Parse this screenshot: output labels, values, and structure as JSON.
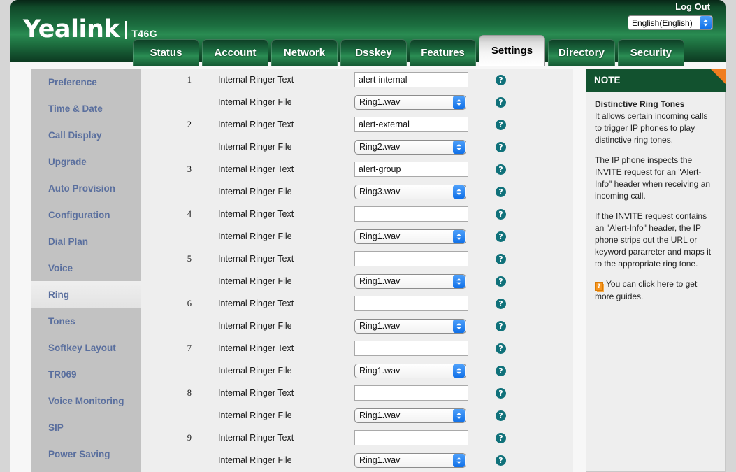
{
  "header": {
    "brand": "Yealink",
    "model": "T46G",
    "logout_label": "Log Out",
    "language_value": "English(English)",
    "accent_green": "#1c6f40",
    "accent_dark_green": "#12522f"
  },
  "tabs": [
    {
      "label": "Status",
      "active": false
    },
    {
      "label": "Account",
      "active": false
    },
    {
      "label": "Network",
      "active": false
    },
    {
      "label": "Dsskey",
      "active": false
    },
    {
      "label": "Features",
      "active": false
    },
    {
      "label": "Settings",
      "active": true
    },
    {
      "label": "Directory",
      "active": false
    },
    {
      "label": "Security",
      "active": false
    }
  ],
  "sidebar": {
    "items": [
      {
        "label": "Preference",
        "active": false
      },
      {
        "label": "Time & Date",
        "active": false
      },
      {
        "label": "Call Display",
        "active": false
      },
      {
        "label": "Upgrade",
        "active": false
      },
      {
        "label": "Auto Provision",
        "active": false
      },
      {
        "label": "Configuration",
        "active": false
      },
      {
        "label": "Dial Plan",
        "active": false
      },
      {
        "label": "Voice",
        "active": false
      },
      {
        "label": "Ring",
        "active": true
      },
      {
        "label": "Tones",
        "active": false
      },
      {
        "label": "Softkey Layout",
        "active": false
      },
      {
        "label": "TR069",
        "active": false
      },
      {
        "label": "Voice Monitoring",
        "active": false
      },
      {
        "label": "SIP",
        "active": false
      },
      {
        "label": "Power Saving",
        "active": false
      }
    ]
  },
  "main": {
    "text_label": "Internal Ringer Text",
    "file_label": "Internal Ringer File",
    "help_glyph": "?",
    "rows": [
      {
        "num": "1",
        "text": "alert-internal",
        "file": "Ring1.wav"
      },
      {
        "num": "2",
        "text": "alert-external",
        "file": "Ring2.wav"
      },
      {
        "num": "3",
        "text": "alert-group",
        "file": "Ring3.wav"
      },
      {
        "num": "4",
        "text": "",
        "file": "Ring1.wav"
      },
      {
        "num": "5",
        "text": "",
        "file": "Ring1.wav"
      },
      {
        "num": "6",
        "text": "",
        "file": "Ring1.wav"
      },
      {
        "num": "7",
        "text": "",
        "file": "Ring1.wav"
      },
      {
        "num": "8",
        "text": "",
        "file": "Ring1.wav"
      },
      {
        "num": "9",
        "text": "",
        "file": "Ring1.wav"
      }
    ]
  },
  "note": {
    "header": "NOTE",
    "title": "Distinctive Ring Tones",
    "paragraph1": "It allows certain incoming calls to trigger IP phones to play distinctive ring tones.",
    "paragraph2": "The IP phone inspects the INVITE request for an \"Alert-Info\" header when receiving an incoming call.",
    "paragraph3": "If the INVITE request contains an \"Alert-Info\" header, the IP phone strips out the URL or keyword pararreter and maps it to the appropriate ring tone.",
    "link_icon_glyph": "?",
    "link_text": "You can click here to get more guides.",
    "corner_color": "#f07d20"
  }
}
